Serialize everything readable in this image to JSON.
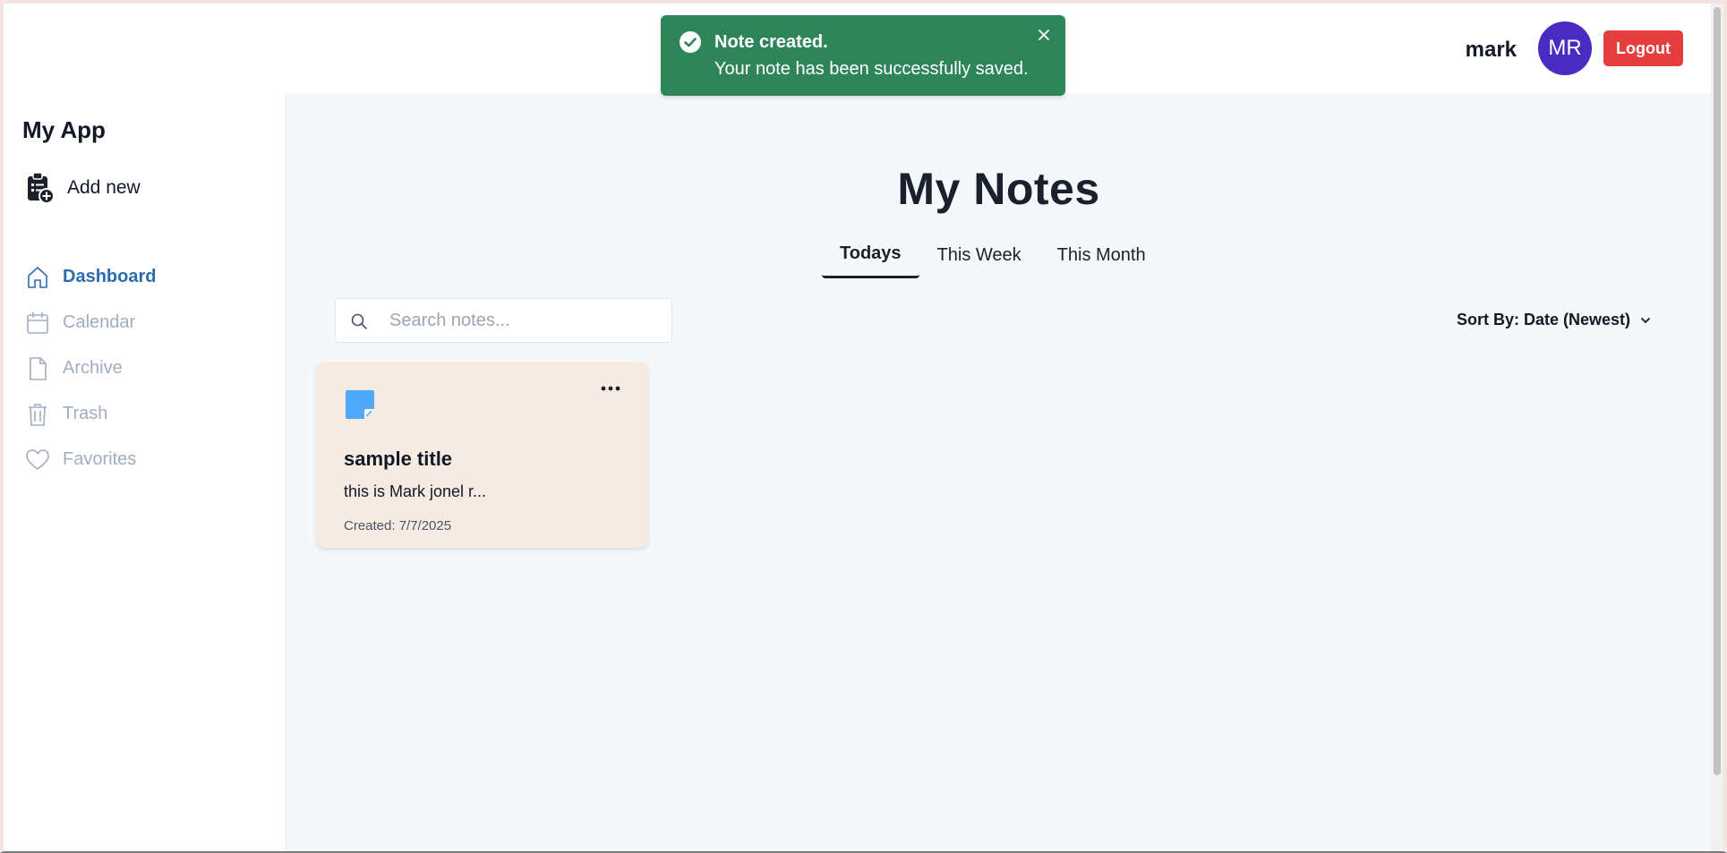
{
  "header": {
    "user_name": "mark",
    "avatar_initials": "MR",
    "logout_label": "Logout"
  },
  "toast": {
    "title": "Note created.",
    "message": "Your note has been successfully saved."
  },
  "sidebar": {
    "brand": "My App",
    "add_new_label": "Add new",
    "items": [
      {
        "label": "Dashboard",
        "icon": "home-icon",
        "active": true
      },
      {
        "label": "Calendar",
        "icon": "calendar-icon"
      },
      {
        "label": "Archive",
        "icon": "file-icon"
      },
      {
        "label": "Trash",
        "icon": "trash-icon"
      },
      {
        "label": "Favorites",
        "icon": "heart-icon"
      }
    ]
  },
  "main": {
    "title": "My Notes",
    "tabs": [
      {
        "label": "Todays",
        "active": true
      },
      {
        "label": "This Week"
      },
      {
        "label": "This Month"
      }
    ],
    "search": {
      "placeholder": "Search notes...",
      "value": ""
    },
    "sort_label": "Sort By: Date (Newest)",
    "notes": [
      {
        "title": "sample title",
        "preview": "this is Mark jonel r...",
        "created": "Created: 7/7/2025"
      }
    ]
  },
  "colors": {
    "accent_blue": "#2b6cb0",
    "toast_green": "#2f855a",
    "logout_red": "#e53e3e",
    "avatar_purple": "#4a2bc2",
    "note_card_bg": "#f6ebe2",
    "note_icon_blue": "#4fa9f8"
  }
}
